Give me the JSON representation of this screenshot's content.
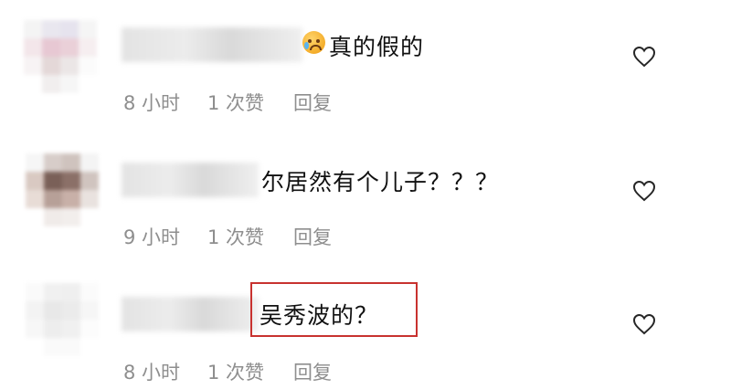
{
  "comments": [
    {
      "text": "真的假的",
      "has_emoji": true,
      "emoji_icon": "crying-face-icon",
      "time": "8 小时",
      "likes": "1 次赞",
      "reply": "回复"
    },
    {
      "text": "尔居然有个儿子？？？",
      "has_emoji": false,
      "time": "9 小时",
      "likes": "1 次赞",
      "reply": "回复"
    },
    {
      "text": "吴秀波的？",
      "has_emoji": false,
      "highlighted": true,
      "highlight_color": "#c8322f",
      "time": "8 小时",
      "likes": "1 次赞",
      "reply": "回复"
    }
  ],
  "icons": {
    "like": "heart-outline-icon"
  }
}
